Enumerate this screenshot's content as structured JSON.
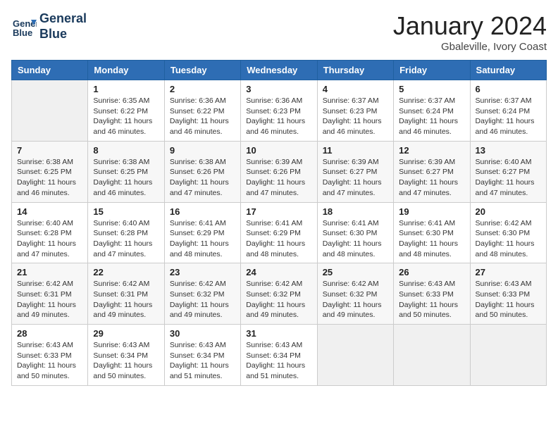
{
  "logo": {
    "line1": "General",
    "line2": "Blue"
  },
  "title": "January 2024",
  "location": "Gbaleville, Ivory Coast",
  "weekdays": [
    "Sunday",
    "Monday",
    "Tuesday",
    "Wednesday",
    "Thursday",
    "Friday",
    "Saturday"
  ],
  "weeks": [
    [
      {
        "day": "",
        "empty": true
      },
      {
        "day": "1",
        "sunrise": "6:35 AM",
        "sunset": "6:22 PM",
        "daylight": "11 hours and 46 minutes."
      },
      {
        "day": "2",
        "sunrise": "6:36 AM",
        "sunset": "6:22 PM",
        "daylight": "11 hours and 46 minutes."
      },
      {
        "day": "3",
        "sunrise": "6:36 AM",
        "sunset": "6:23 PM",
        "daylight": "11 hours and 46 minutes."
      },
      {
        "day": "4",
        "sunrise": "6:37 AM",
        "sunset": "6:23 PM",
        "daylight": "11 hours and 46 minutes."
      },
      {
        "day": "5",
        "sunrise": "6:37 AM",
        "sunset": "6:24 PM",
        "daylight": "11 hours and 46 minutes."
      },
      {
        "day": "6",
        "sunrise": "6:37 AM",
        "sunset": "6:24 PM",
        "daylight": "11 hours and 46 minutes."
      }
    ],
    [
      {
        "day": "7",
        "sunrise": "6:38 AM",
        "sunset": "6:25 PM",
        "daylight": "11 hours and 46 minutes."
      },
      {
        "day": "8",
        "sunrise": "6:38 AM",
        "sunset": "6:25 PM",
        "daylight": "11 hours and 46 minutes."
      },
      {
        "day": "9",
        "sunrise": "6:38 AM",
        "sunset": "6:26 PM",
        "daylight": "11 hours and 47 minutes."
      },
      {
        "day": "10",
        "sunrise": "6:39 AM",
        "sunset": "6:26 PM",
        "daylight": "11 hours and 47 minutes."
      },
      {
        "day": "11",
        "sunrise": "6:39 AM",
        "sunset": "6:27 PM",
        "daylight": "11 hours and 47 minutes."
      },
      {
        "day": "12",
        "sunrise": "6:39 AM",
        "sunset": "6:27 PM",
        "daylight": "11 hours and 47 minutes."
      },
      {
        "day": "13",
        "sunrise": "6:40 AM",
        "sunset": "6:27 PM",
        "daylight": "11 hours and 47 minutes."
      }
    ],
    [
      {
        "day": "14",
        "sunrise": "6:40 AM",
        "sunset": "6:28 PM",
        "daylight": "11 hours and 47 minutes."
      },
      {
        "day": "15",
        "sunrise": "6:40 AM",
        "sunset": "6:28 PM",
        "daylight": "11 hours and 47 minutes."
      },
      {
        "day": "16",
        "sunrise": "6:41 AM",
        "sunset": "6:29 PM",
        "daylight": "11 hours and 48 minutes."
      },
      {
        "day": "17",
        "sunrise": "6:41 AM",
        "sunset": "6:29 PM",
        "daylight": "11 hours and 48 minutes."
      },
      {
        "day": "18",
        "sunrise": "6:41 AM",
        "sunset": "6:30 PM",
        "daylight": "11 hours and 48 minutes."
      },
      {
        "day": "19",
        "sunrise": "6:41 AM",
        "sunset": "6:30 PM",
        "daylight": "11 hours and 48 minutes."
      },
      {
        "day": "20",
        "sunrise": "6:42 AM",
        "sunset": "6:30 PM",
        "daylight": "11 hours and 48 minutes."
      }
    ],
    [
      {
        "day": "21",
        "sunrise": "6:42 AM",
        "sunset": "6:31 PM",
        "daylight": "11 hours and 49 minutes."
      },
      {
        "day": "22",
        "sunrise": "6:42 AM",
        "sunset": "6:31 PM",
        "daylight": "11 hours and 49 minutes."
      },
      {
        "day": "23",
        "sunrise": "6:42 AM",
        "sunset": "6:32 PM",
        "daylight": "11 hours and 49 minutes."
      },
      {
        "day": "24",
        "sunrise": "6:42 AM",
        "sunset": "6:32 PM",
        "daylight": "11 hours and 49 minutes."
      },
      {
        "day": "25",
        "sunrise": "6:42 AM",
        "sunset": "6:32 PM",
        "daylight": "11 hours and 49 minutes."
      },
      {
        "day": "26",
        "sunrise": "6:43 AM",
        "sunset": "6:33 PM",
        "daylight": "11 hours and 50 minutes."
      },
      {
        "day": "27",
        "sunrise": "6:43 AM",
        "sunset": "6:33 PM",
        "daylight": "11 hours and 50 minutes."
      }
    ],
    [
      {
        "day": "28",
        "sunrise": "6:43 AM",
        "sunset": "6:33 PM",
        "daylight": "11 hours and 50 minutes."
      },
      {
        "day": "29",
        "sunrise": "6:43 AM",
        "sunset": "6:34 PM",
        "daylight": "11 hours and 50 minutes."
      },
      {
        "day": "30",
        "sunrise": "6:43 AM",
        "sunset": "6:34 PM",
        "daylight": "11 hours and 51 minutes."
      },
      {
        "day": "31",
        "sunrise": "6:43 AM",
        "sunset": "6:34 PM",
        "daylight": "11 hours and 51 minutes."
      },
      {
        "day": "",
        "empty": true
      },
      {
        "day": "",
        "empty": true
      },
      {
        "day": "",
        "empty": true
      }
    ]
  ]
}
